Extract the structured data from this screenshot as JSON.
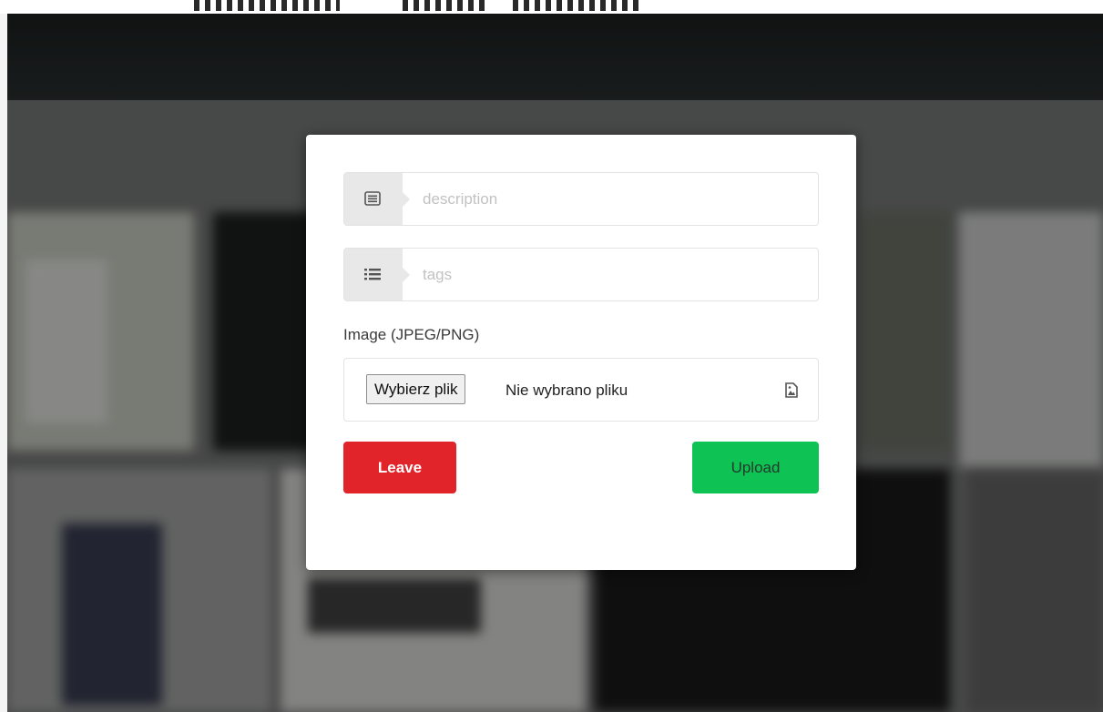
{
  "form": {
    "description_placeholder": "description",
    "tags_placeholder": "tags",
    "image_label": "Image (JPEG/PNG)",
    "file_button_label": "Wybierz plik",
    "file_status": "Nie wybrano pliku",
    "leave_label": "Leave",
    "upload_label": "Upload"
  },
  "icons": {
    "description": "list-alt-icon",
    "tags": "list-icon",
    "file": "file-image-icon"
  },
  "colors": {
    "leave_button": "#e1242a",
    "upload_button": "#0fc254",
    "addon_background": "#e8e8e8"
  }
}
